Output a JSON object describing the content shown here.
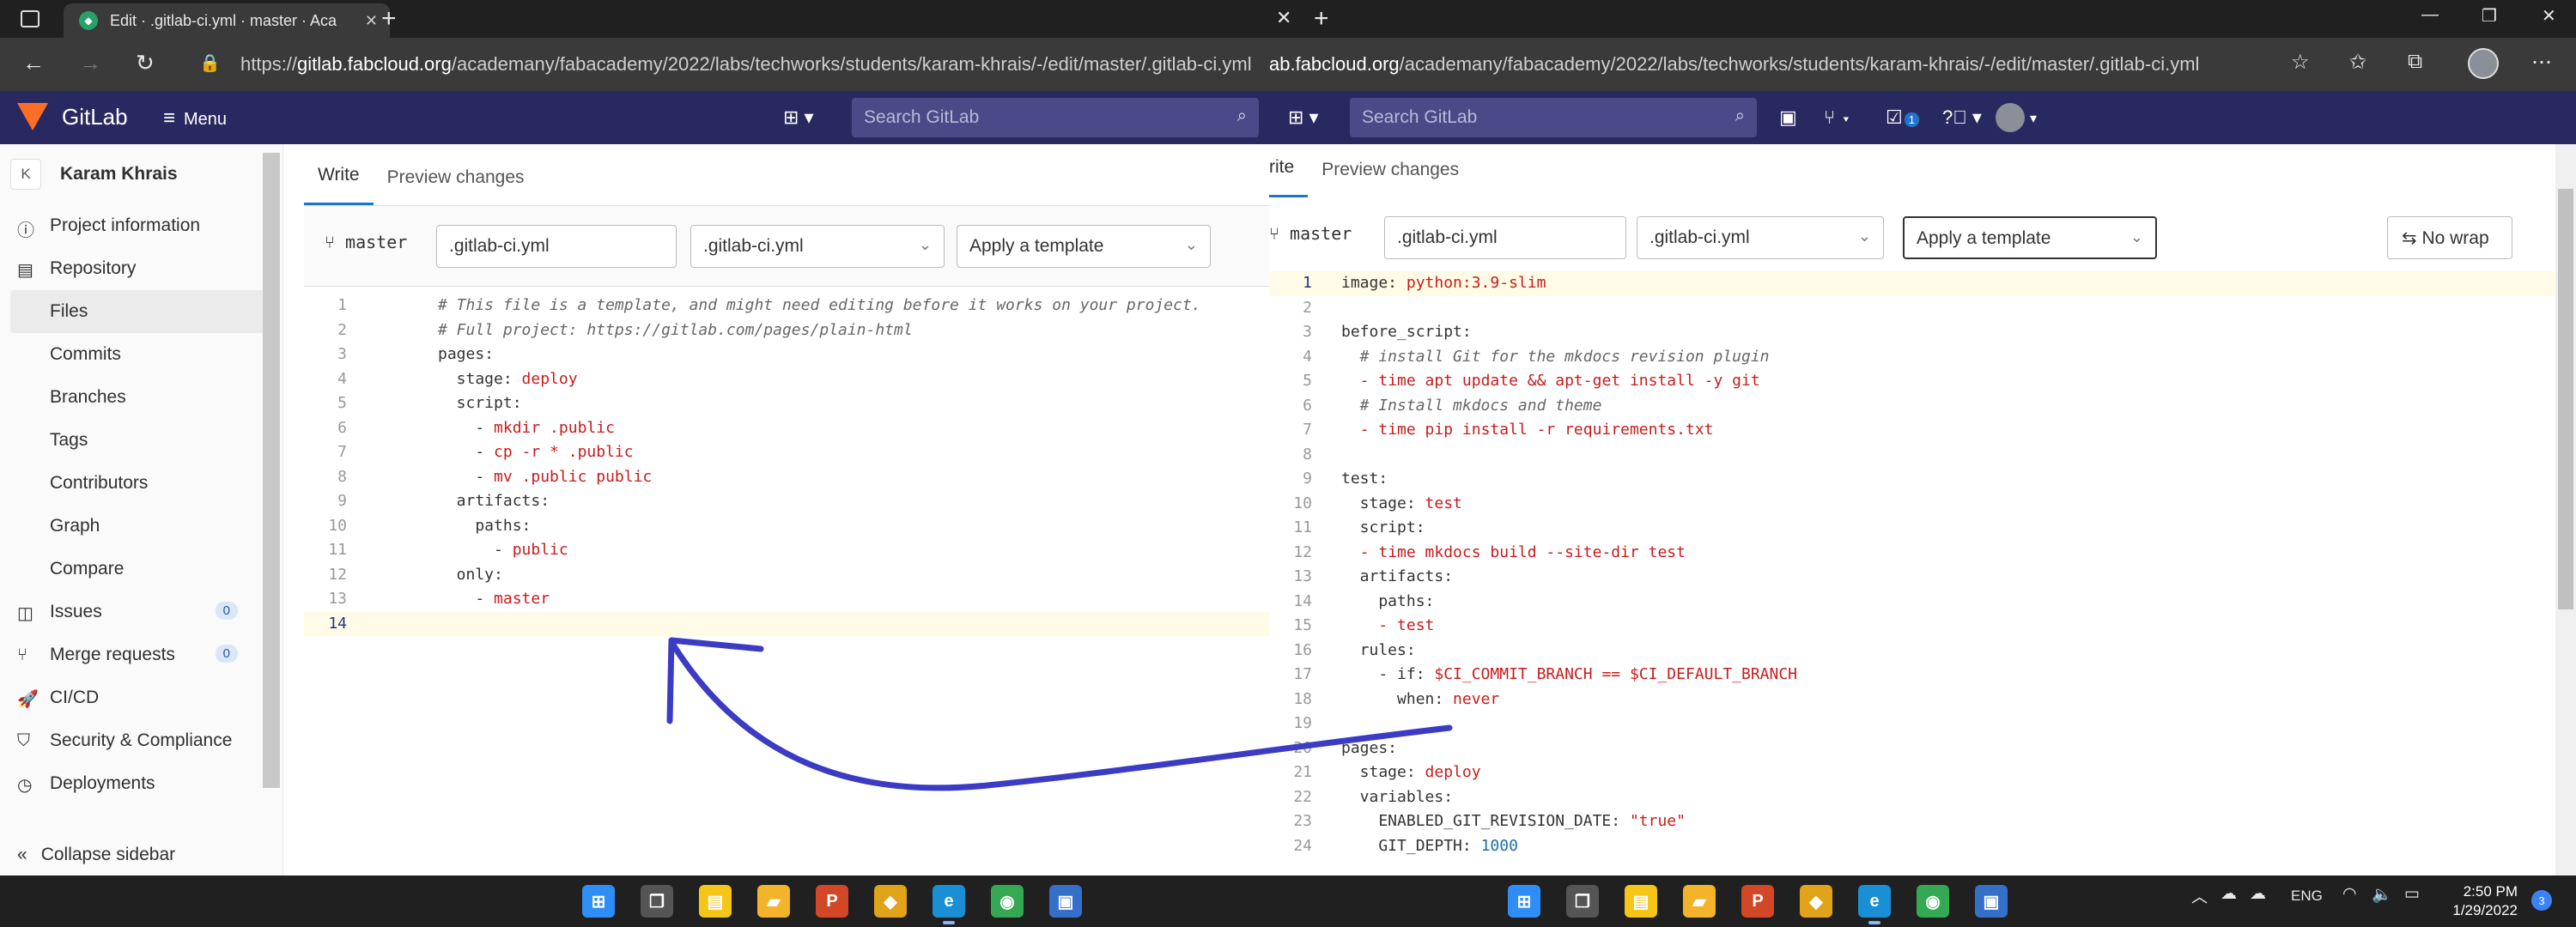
{
  "left_window": {
    "tab_title": "Edit · .gitlab-ci.yml · master · Aca",
    "url_prefix": "https://",
    "url_host": "gitlab.fabcloud.org",
    "url_path": "/academany/fabacademy/2022/labs/techworks/students/karam-khrais/-/edit/master/.gitlab-ci.yml",
    "gitlab": {
      "brand": "GitLab",
      "menu": "Menu",
      "search_placeholder": "Search GitLab"
    },
    "sidebar": {
      "project_initial": "K",
      "project_name": "Karam Khrais",
      "items": [
        {
          "label": "Project information",
          "icon": "info-icon"
        },
        {
          "label": "Repository",
          "icon": "book-icon"
        },
        {
          "label": "Files",
          "active": true
        },
        {
          "label": "Commits"
        },
        {
          "label": "Branches"
        },
        {
          "label": "Tags"
        },
        {
          "label": "Contributors"
        },
        {
          "label": "Graph"
        },
        {
          "label": "Compare"
        },
        {
          "label": "Issues",
          "icon": "issues-icon",
          "count": "0"
        },
        {
          "label": "Merge requests",
          "icon": "merge-request-icon",
          "count": "0"
        },
        {
          "label": "CI/CD",
          "icon": "rocket-icon"
        },
        {
          "label": "Security & Compliance",
          "icon": "shield-icon"
        },
        {
          "label": "Deployments",
          "icon": "deployments-icon"
        }
      ],
      "collapse": "Collapse sidebar"
    },
    "editor": {
      "tab_write": "Write",
      "tab_preview": "Preview changes",
      "branch": "master",
      "filename": ".gitlab-ci.yml",
      "filetype": ".gitlab-ci.yml",
      "template": "Apply a template",
      "lines": [
        [
          {
            "t": "# This file is a template, and might need editing before it works on your project.",
            "c": "c"
          }
        ],
        [
          {
            "t": "# Full project: https://gitlab.com/pages/plain-html",
            "c": "c"
          }
        ],
        [
          {
            "t": "pages:",
            "c": "k"
          }
        ],
        [
          {
            "t": "  stage: ",
            "c": "k"
          },
          {
            "t": "deploy",
            "c": "s"
          }
        ],
        [
          {
            "t": "  script:",
            "c": "k"
          }
        ],
        [
          {
            "t": "    - ",
            "c": "k"
          },
          {
            "t": "mkdir .public",
            "c": "s"
          }
        ],
        [
          {
            "t": "    - ",
            "c": "k"
          },
          {
            "t": "cp -r * .public",
            "c": "s"
          }
        ],
        [
          {
            "t": "    - ",
            "c": "k"
          },
          {
            "t": "mv .public public",
            "c": "s"
          }
        ],
        [
          {
            "t": "  artifacts:",
            "c": "k"
          }
        ],
        [
          {
            "t": "    paths:",
            "c": "k"
          }
        ],
        [
          {
            "t": "      - ",
            "c": "k"
          },
          {
            "t": "public",
            "c": "s"
          }
        ],
        [
          {
            "t": "  only:",
            "c": "k"
          }
        ],
        [
          {
            "t": "    - ",
            "c": "k"
          },
          {
            "t": "master",
            "c": "s"
          }
        ],
        []
      ]
    }
  },
  "right_window": {
    "url_host": "ab.fabcloud.org",
    "url_path": "/academany/fabacademy/2022/labs/techworks/students/karam-khrais/-/edit/master/.gitlab-ci.yml",
    "gitlab": {
      "search_placeholder": "Search GitLab",
      "todo_count": "1"
    },
    "editor": {
      "tab_write": "rite",
      "tab_preview": "Preview changes",
      "branch": "master",
      "filename": ".gitlab-ci.yml",
      "filetype": ".gitlab-ci.yml",
      "template": "Apply a template",
      "nowrap": "No wrap",
      "lines": [
        [
          {
            "t": "image: ",
            "c": "k"
          },
          {
            "t": "python:3.9-slim",
            "c": "s"
          }
        ],
        [],
        [
          {
            "t": "before_script:",
            "c": "k"
          }
        ],
        [
          {
            "t": "  # install Git for the mkdocs revision plugin",
            "c": "c"
          }
        ],
        [
          {
            "t": "  - ",
            "c": "s"
          },
          {
            "t": "time apt update && apt-get install -y git",
            "c": "s"
          }
        ],
        [
          {
            "t": "  # Install mkdocs and theme",
            "c": "c"
          }
        ],
        [
          {
            "t": "  - ",
            "c": "s"
          },
          {
            "t": "time pip install -r requirements.txt",
            "c": "s"
          }
        ],
        [],
        [
          {
            "t": "test:",
            "c": "k"
          }
        ],
        [
          {
            "t": "  stage: ",
            "c": "k"
          },
          {
            "t": "test",
            "c": "s"
          }
        ],
        [
          {
            "t": "  script:",
            "c": "k"
          }
        ],
        [
          {
            "t": "  - ",
            "c": "s"
          },
          {
            "t": "time mkdocs build --site-dir test",
            "c": "s"
          }
        ],
        [
          {
            "t": "  artifacts:",
            "c": "k"
          }
        ],
        [
          {
            "t": "    paths:",
            "c": "k"
          }
        ],
        [
          {
            "t": "    - ",
            "c": "s"
          },
          {
            "t": "test",
            "c": "s"
          }
        ],
        [
          {
            "t": "  rules:",
            "c": "k"
          }
        ],
        [
          {
            "t": "    - if: ",
            "c": "k"
          },
          {
            "t": "$CI_COMMIT_BRANCH == $CI_DEFAULT_BRANCH",
            "c": "s"
          }
        ],
        [
          {
            "t": "      when: ",
            "c": "k"
          },
          {
            "t": "never",
            "c": "s"
          }
        ],
        [],
        [
          {
            "t": "pages:",
            "c": "k"
          }
        ],
        [
          {
            "t": "  stage: ",
            "c": "k"
          },
          {
            "t": "deploy",
            "c": "s"
          }
        ],
        [
          {
            "t": "  variables:",
            "c": "k"
          }
        ],
        [
          {
            "t": "    ENABLED_GIT_REVISION_DATE: ",
            "c": "k"
          },
          {
            "t": "\"true\"",
            "c": "s"
          }
        ],
        [
          {
            "t": "    GIT_DEPTH: ",
            "c": "k"
          },
          {
            "t": "1000",
            "c": "n"
          }
        ]
      ]
    }
  },
  "taskbar": {
    "left_apps": [
      "start-icon",
      "task-view-icon",
      "sticky-notes-icon",
      "file-explorer-icon",
      "powerpoint-icon",
      "git-icon",
      "edge-icon",
      "chrome-icon",
      "app-icon"
    ],
    "right_apps": [
      "start-icon",
      "task-view-icon",
      "sticky-notes-icon",
      "file-explorer-icon",
      "powerpoint-icon",
      "git-icon",
      "edge-icon",
      "chrome-icon",
      "app-icon"
    ],
    "language": "ENG",
    "time": "2:50 PM",
    "date": "1/29/2022",
    "notifications": "3"
  },
  "colors": {
    "gitlab_nav": "#292961",
    "accent": "#1f75cb",
    "annotation_arrow": "#3b3bc4",
    "string": "#c91c1c"
  }
}
